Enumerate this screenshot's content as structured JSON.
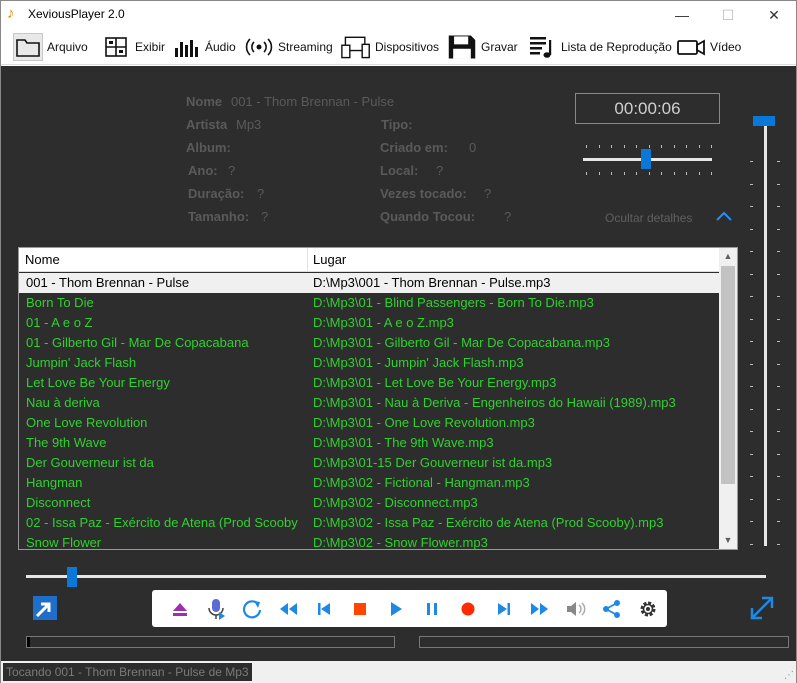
{
  "window": {
    "title": "XeviousPlayer 2.0",
    "min_label": "—",
    "max_label": "☐",
    "close_label": "✕"
  },
  "toolbar": [
    {
      "label": "Arquivo",
      "icon": "folder-icon"
    },
    {
      "label": "Exibir",
      "icon": "grid-icon"
    },
    {
      "label": "Áudio",
      "icon": "equalizer-icon"
    },
    {
      "label": "Streaming",
      "icon": "broadcast-icon"
    },
    {
      "label": "Dispositivos",
      "icon": "devices-icon"
    },
    {
      "label": "Gravar",
      "icon": "save-icon"
    },
    {
      "label": "Lista de Reprodução",
      "icon": "playlist-icon"
    },
    {
      "label": "Vídeo",
      "icon": "video-camera-icon"
    }
  ],
  "details": {
    "nome_label": "Nome",
    "nome_value": "001 - Thom Brennan - Pulse",
    "artista_label": "Artista",
    "artista_value": "Mp3",
    "album_label": "Album:",
    "ano_label": "Ano:",
    "ano_value": "?",
    "duracao_label": "Duração:",
    "duracao_value": "?",
    "tamanho_label": "Tamanho:",
    "tamanho_value": "?",
    "tipo_label": "Tipo:",
    "criado_label": "Criado em:",
    "criado_value": "0",
    "local_label": "Local:",
    "local_value": "?",
    "vezes_label": "Vezes tocado:",
    "vezes_value": "?",
    "quando_label": "Quando Tocou:",
    "quando_value": "?",
    "hide_label": "Ocultar detalhes"
  },
  "time": "00:00:06",
  "volume_level": 0.49,
  "position_level": 0.057,
  "table": {
    "headers": [
      "Nome",
      "Lugar"
    ],
    "rows": [
      {
        "nome": "001 - Thom Brennan - Pulse",
        "lugar": "D:\\Mp3\\001 - Thom Brennan - Pulse.mp3"
      },
      {
        "nome": "Born To Die",
        "lugar": "D:\\Mp3\\01 -  Blind Passengers - Born To Die.mp3"
      },
      {
        "nome": "01 - A e o Z",
        "lugar": "D:\\Mp3\\01 - A e o Z.mp3"
      },
      {
        "nome": "01 - Gilberto Gil - Mar De Copacabana",
        "lugar": "D:\\Mp3\\01 - Gilberto Gil - Mar De Copacabana.mp3"
      },
      {
        "nome": "Jumpin' Jack Flash",
        "lugar": "D:\\Mp3\\01 - Jumpin' Jack Flash.mp3"
      },
      {
        "nome": "Let Love Be Your Energy",
        "lugar": "D:\\Mp3\\01 - Let Love Be Your Energy.mp3"
      },
      {
        "nome": "Nau à deriva",
        "lugar": "D:\\Mp3\\01 - Nau à Deriva - Engenheiros do Hawaii (1989).mp3"
      },
      {
        "nome": "One Love Revolution",
        "lugar": "D:\\Mp3\\01 - One Love Revolution.mp3"
      },
      {
        "nome": "The 9th Wave",
        "lugar": "D:\\Mp3\\01 - The 9th Wave.mp3"
      },
      {
        "nome": "Der Gouverneur ist da",
        "lugar": "D:\\Mp3\\01-15 Der Gouverneur ist da.mp3"
      },
      {
        "nome": "Hangman",
        "lugar": "D:\\Mp3\\02 -  Fictional - Hangman.mp3"
      },
      {
        "nome": "Disconnect",
        "lugar": "D:\\Mp3\\02 - Disconnect.mp3"
      },
      {
        "nome": "02 - Issa Paz - Exército de Atena (Prod Scooby",
        "lugar": "D:\\Mp3\\02 - Issa Paz - Exército de Atena (Prod Scooby).mp3"
      },
      {
        "nome": "Snow Flower",
        "lugar": "D:\\Mp3\\02 - Snow Flower.mp3"
      }
    ]
  },
  "controls": [
    "eject-icon",
    "microphone-icon",
    "repeat-icon",
    "rewind-icon",
    "previous-icon",
    "stop-icon",
    "play-icon",
    "pause-icon",
    "record-icon",
    "next-icon",
    "fast-forward-icon",
    "speaker-icon",
    "share-icon",
    "settings-icon"
  ],
  "status": "Tocando 001 - Thom Brennan - Pulse de Mp3",
  "colors": {
    "background": "#2d2d2d",
    "accent": "#0a78d7",
    "track_text": "#2ed12e",
    "stop": "#ff4500",
    "record": "#ff2a00",
    "eject": "#9b2fae"
  }
}
